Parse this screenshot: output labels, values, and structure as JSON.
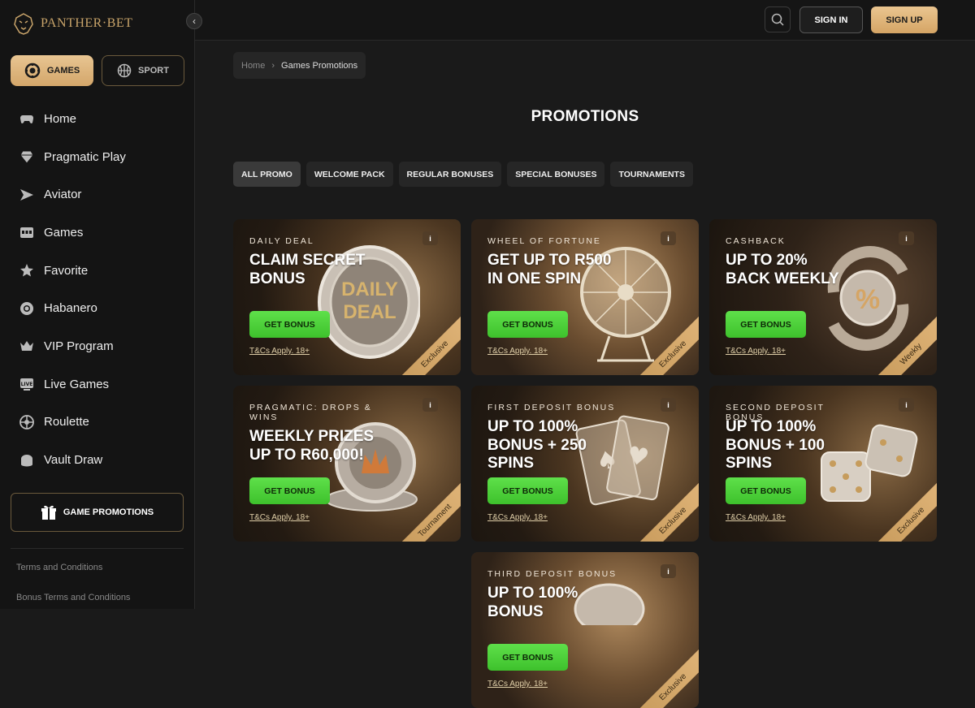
{
  "brand": {
    "name": "PANTHER·BET",
    "accent": "#d3a66a"
  },
  "sidebar": {
    "modes": [
      {
        "label": "GAMES",
        "icon": "chip-icon"
      },
      {
        "label": "SPORT",
        "icon": "basketball-icon"
      }
    ],
    "items": [
      {
        "label": "Home",
        "icon": "gamepad-icon"
      },
      {
        "label": "Pragmatic Play",
        "icon": "diamond-icon"
      },
      {
        "label": "Aviator",
        "icon": "plane-icon"
      },
      {
        "label": "Games",
        "icon": "slot-machine-icon"
      },
      {
        "label": "Favorite",
        "icon": "star-icon"
      },
      {
        "label": "Habanero",
        "icon": "chip-icon"
      },
      {
        "label": "VIP Program",
        "icon": "crown-icon"
      },
      {
        "label": "Live Games",
        "icon": "live-tv-icon"
      },
      {
        "label": "Roulette",
        "icon": "roulette-icon"
      },
      {
        "label": "Vault Draw",
        "icon": "vault-icon"
      }
    ],
    "promotions_label": "GAME PROMOTIONS",
    "footer_links": [
      "Terms and Conditions",
      "Bonus Terms and Conditions"
    ]
  },
  "header": {
    "signin_label": "SIGN IN",
    "signup_label": "SIGN UP"
  },
  "breadcrumb": {
    "home": "Home",
    "current": "Games Promotions"
  },
  "page_title": "PROMOTIONS",
  "filters": [
    "ALL PROMO",
    "WELCOME PACK",
    "REGULAR BONUSES",
    "SPECIAL BONUSES",
    "TOURNAMENTS"
  ],
  "cards": [
    {
      "subtitle": "DAILY DEAL",
      "title": "CLAIM SECRET BONUS",
      "button": "GET BONUS",
      "tc": "T&Cs Apply. 18+",
      "ribbon": "Exclusive",
      "art": "daily-deal-chip"
    },
    {
      "subtitle": "WHEEL OF FORTUNE",
      "title": "GET UP TO R500 IN ONE SPIN",
      "button": "GET BONUS",
      "tc": "T&Cs Apply. 18+",
      "ribbon": "Exclusive",
      "art": "fortune-wheel"
    },
    {
      "subtitle": "CASHBACK",
      "title": "UP TO 20% BACK WEEKLY",
      "button": "GET BONUS",
      "tc": "T&Cs Apply. 18+",
      "ribbon": "Weekly",
      "art": "cashback-percent"
    },
    {
      "subtitle": "PRAGMATIC: DROPS & WINS",
      "title": "WEEKLY PRIZES UP TO R60,000!",
      "button": "GET BONUS",
      "tc": "T&Cs Apply. 18+",
      "ribbon": "Tournament",
      "art": "crown-chip"
    },
    {
      "subtitle": "FIRST DEPOSIT BONUS",
      "title": "UP TO 100% BONUS + 250 SPINS",
      "button": "GET BONUS",
      "tc": "T&Cs Apply. 18+",
      "ribbon": "Exclusive",
      "art": "playing-cards"
    },
    {
      "subtitle": "SECOND DEPOSIT BONUS",
      "title": "UP TO 100% BONUS + 100 SPINS",
      "button": "GET BONUS",
      "tc": "T&Cs Apply. 18+",
      "ribbon": "Exclusive",
      "art": "dice"
    },
    {
      "subtitle": "THIRD DEPOSIT BONUS",
      "title": "UP TO 100% BONUS",
      "button": "GET BONUS",
      "tc": "T&Cs Apply. 18+",
      "ribbon": "Exclusive",
      "art": "chip"
    }
  ]
}
